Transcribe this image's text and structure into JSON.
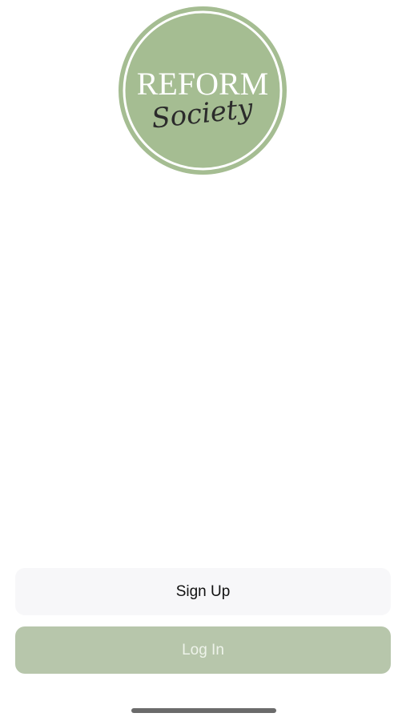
{
  "logo": {
    "line1": "REFORM",
    "line2": "Society",
    "fill_color": "#a5bd92",
    "ring_color": "#ffffff"
  },
  "actions": {
    "signup_label": "Sign Up",
    "login_label": "Log In"
  },
  "colors": {
    "signup_bg": "#f7f7f9",
    "login_bg": "#b7c6ab"
  }
}
